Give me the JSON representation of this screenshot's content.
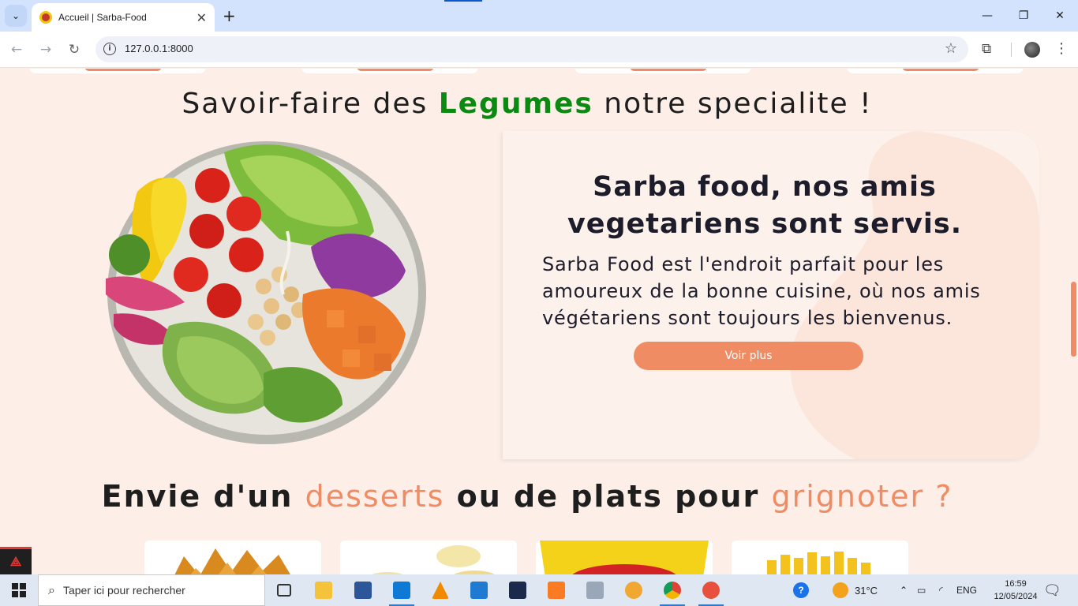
{
  "browser": {
    "tab_title": "Accueil | Sarba-Food",
    "url": "127.0.0.1:8000",
    "new_tab_symbol": "+",
    "close_tab_symbol": "✕"
  },
  "page": {
    "section1": {
      "title_before": "Savoir-faire des ",
      "title_highlight": "Legumes",
      "title_after": " notre specialite !"
    },
    "promo": {
      "title": "Sarba food, nos amis vegetariens sont servis.",
      "text": "Sarba Food est l'endroit parfait pour les amoureux de la bonne cuisine, où nos amis végétariens sont toujours les bienvenus.",
      "button_label": "Voir plus"
    },
    "section2": {
      "title_part1": "Envie d'un ",
      "title_highlight1": "desserts",
      "title_part2": " ou de plats pour ",
      "title_highlight2": "grignoter ?"
    },
    "accent_color": "#f08c63",
    "highlight_green": "#0b8a12"
  },
  "taskbar": {
    "search_placeholder": "Taper ici pour rechercher",
    "weather": "31°C",
    "language": "ENG",
    "time": "16:59",
    "date": "12/05/2024"
  }
}
